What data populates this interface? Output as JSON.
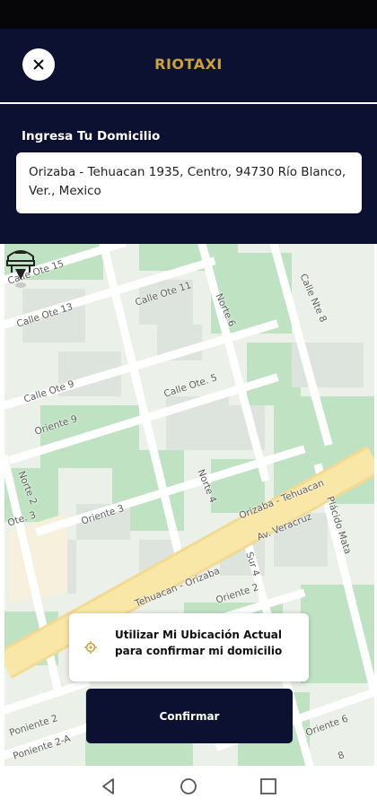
{
  "header": {
    "title": "RIOTAXI"
  },
  "address": {
    "label": "Ingresa Tu Domicilio",
    "value": "Orizaba - Tehuacan 1935, Centro, 94730 Río Blanco, Ver., Mexico"
  },
  "map": {
    "street_labels": [
      "Calle Ote 15",
      "Calle Ote 13",
      "Calle Ote 11",
      "Norte 6",
      "Calle Nte 8",
      "Calle Ote 9",
      "Calle Ote. 5",
      "Oriente 9",
      "Norte 2",
      "Norte 4",
      "Oriente 3",
      "Ote. 3",
      "Orizaba - Tehuacan",
      "Av. Veracruz",
      "Plácido Mata",
      "Tehuacan - Orizaba",
      "Sur 4",
      "Oriente 2",
      "Poniente 2",
      "Poniente 2-A",
      "Oriente 6",
      "8"
    ]
  },
  "location_card": {
    "text": "Utilizar Mi Ubicación Actual para confirmar mi domicilio"
  },
  "confirm_button": {
    "label": "Confirmar"
  },
  "colors": {
    "navy": "#0d1131",
    "gold": "#c9a23c",
    "map_background": "#ebf0e8",
    "park_green": "#bfe3c2",
    "main_road": "#f8e7a6"
  },
  "icons": [
    "close-icon",
    "pin-icon",
    "location-icon",
    "back-icon",
    "home-icon",
    "recents-icon"
  ]
}
